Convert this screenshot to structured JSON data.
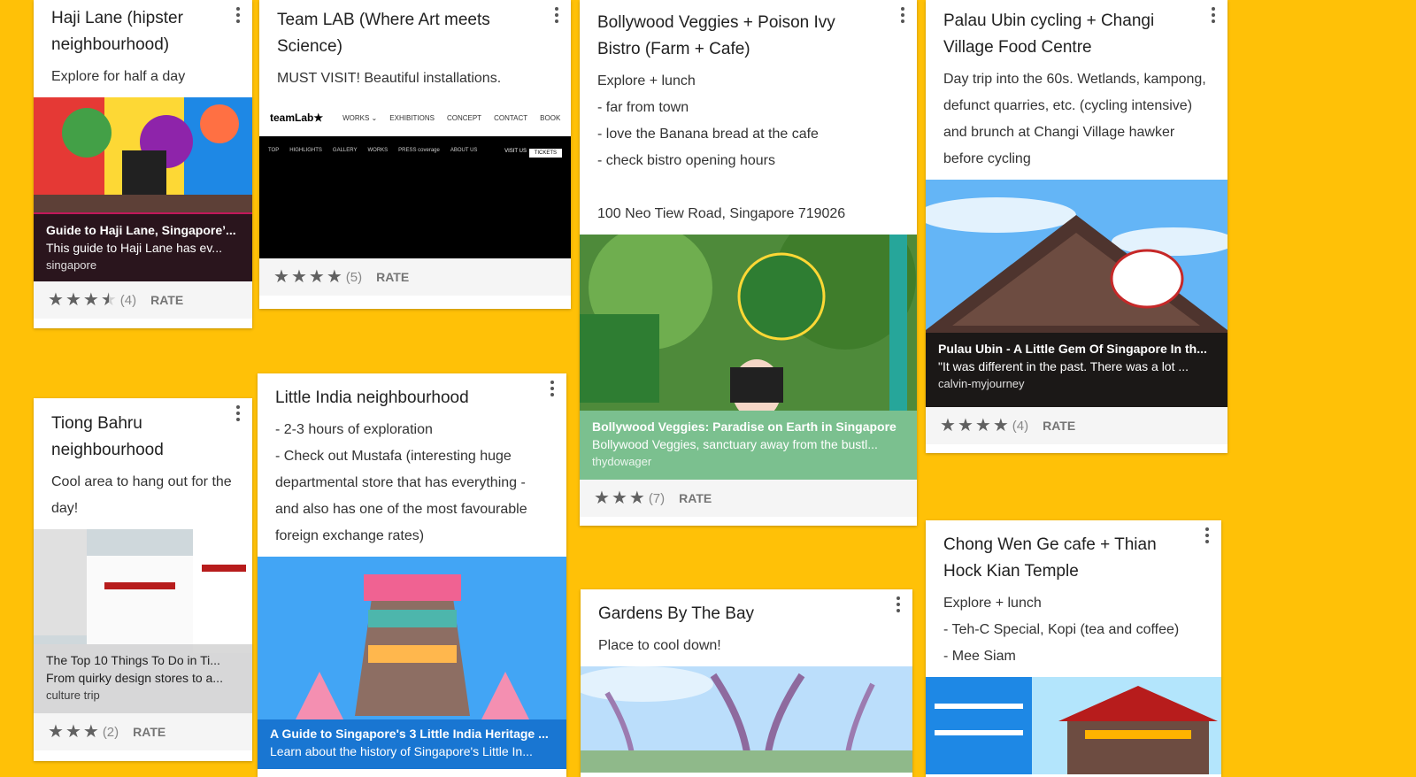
{
  "cards": {
    "haji": {
      "title": "Haji Lane (hipster neighbourhood)",
      "desc": "Explore for half a day",
      "link_title": "Guide to Haji Lane, Singapore’...",
      "link_desc": "This guide to Haji Lane has ev...",
      "link_src": "singapore",
      "rating_count": "(4)",
      "rate_label": "RATE"
    },
    "teamlab": {
      "title": "Team LAB (Where Art meets Science)",
      "desc": "MUST VISIT! Beautiful installations.",
      "site_logo": "teamLab★",
      "site_menu": [
        "WORKS ⌄",
        "EXHIBITIONS",
        "CONCEPT",
        "CONTACT",
        "BOOK"
      ],
      "site_nav": [
        "TOP",
        "HIGHLIGHTS",
        "GALLERY",
        "WORKS",
        "PRESS coverage",
        "ABOUT US"
      ],
      "site_visit": "VISIT US",
      "site_tickets": "TICKETS",
      "rating_count": "(5)",
      "rate_label": "RATE"
    },
    "bollywood": {
      "title": "Bollywood Veggies + Poison Ivy Bistro (Farm + Cafe)",
      "desc": "Explore + lunch\n- far from town\n- love the Banana bread at the cafe\n- check bistro opening hours\n\n100 Neo Tiew Road, Singapore 719026",
      "link_title": "Bollywood Veggies: Paradise on Earth in Singapore",
      "link_desc": "Bollywood Veggies, sanctuary away from the bustl...",
      "link_src": "thydowager",
      "rating_count": "(7)",
      "rate_label": "RATE"
    },
    "ubin": {
      "title": "Palau Ubin cycling + Changi Village Food Centre",
      "desc": "Day trip into the 60s. Wetlands, kampong, defunct quarries, etc. (cycling intensive) and brunch at Changi Village hawker before cycling",
      "link_title": "Pulau Ubin - A Little Gem Of Singapore In th...",
      "link_desc": "\"It was different in the past. There was a lot ...",
      "link_src": "calvin-myjourney",
      "rating_count": "(4)",
      "rate_label": "RATE"
    },
    "tiong": {
      "title": "Tiong Bahru neighbourhood",
      "desc": "Cool area to hang out for the day!",
      "link_title": "The Top 10 Things To Do in Ti...",
      "link_desc": "From quirky design stores to a...",
      "link_src": "culture trip",
      "rating_count": "(2)",
      "rate_label": "RATE"
    },
    "india": {
      "title": "Little India neighbourhood",
      "desc": "- 2-3 hours of exploration\n- Check out Mustafa (interesting huge departmental store that has everything - and also has one of the most favourable foreign exchange rates)",
      "link_title": "A Guide to Singapore's 3 Little India Heritage ...",
      "link_desc": "Learn about the history of Singapore's Little In..."
    },
    "gardens": {
      "title": "Gardens By The Bay",
      "desc": "Place to cool down!"
    },
    "chong": {
      "title": "Chong Wen Ge cafe + Thian Hock Kian Temple",
      "desc": "Explore + lunch\n- Teh-C Special, Kopi (tea and coffee)\n- Mee Siam"
    }
  },
  "colors": {
    "background": "#FFC107",
    "green_link": "#7BC08F",
    "blue_link": "#1976D2"
  },
  "icons": {
    "menu": "more-vert-icon",
    "star": "star-icon"
  }
}
